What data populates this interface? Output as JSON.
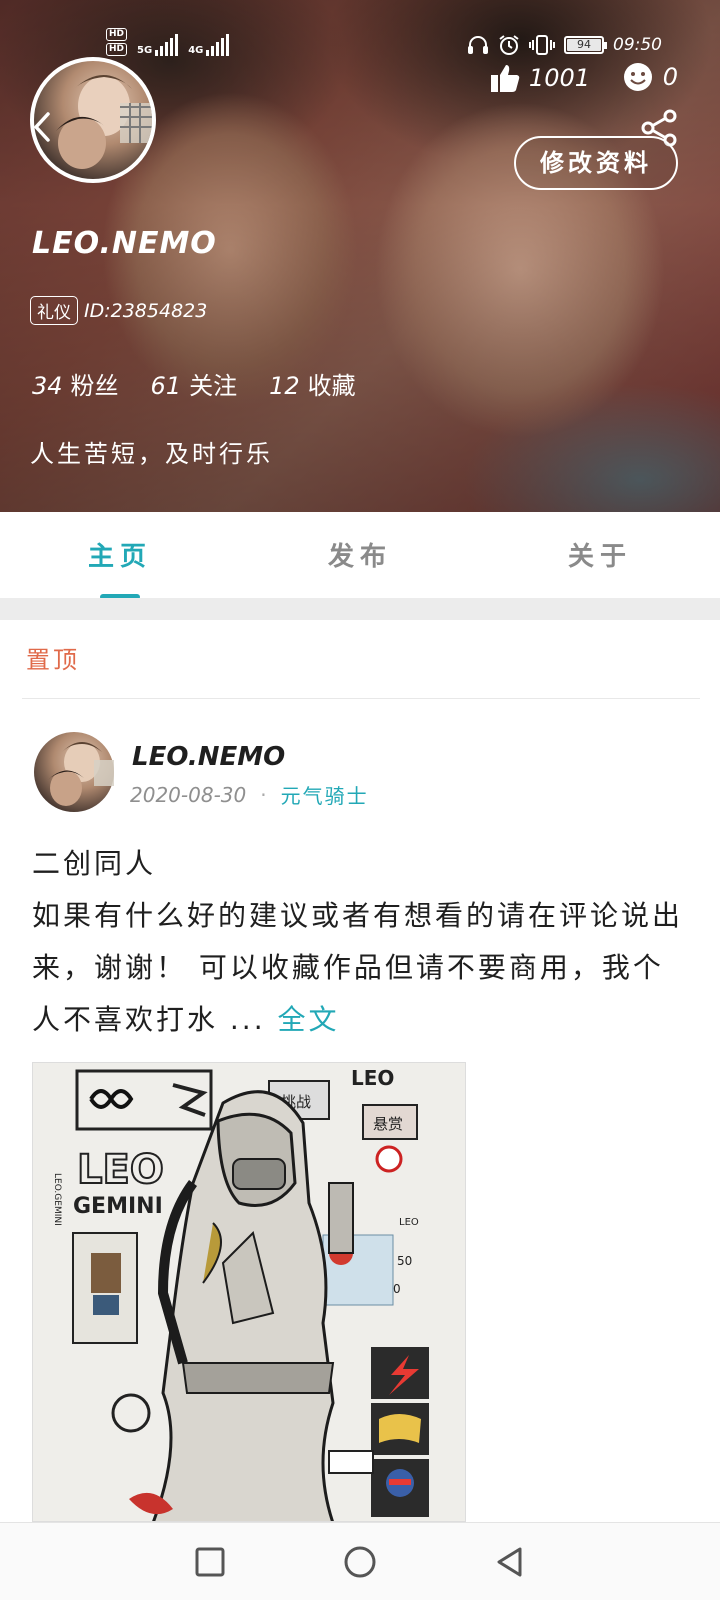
{
  "status_bar": {
    "hd1": "HD",
    "hd2": "HD",
    "net1": "5G",
    "net2": "4G",
    "battery": "94",
    "time": "09:50"
  },
  "profile": {
    "likes": "1001",
    "faces": "0",
    "edit_label": "修改资料",
    "username": "LEO.NEMO",
    "badge": "礼仪",
    "id_text": "ID:23854823",
    "stats": [
      {
        "num": "34",
        "label": "粉丝"
      },
      {
        "num": "61",
        "label": "关注"
      },
      {
        "num": "12",
        "label": "收藏"
      }
    ],
    "bio": "人生苦短，及时行乐"
  },
  "tabs": [
    {
      "label": "主页",
      "active": true
    },
    {
      "label": "发布",
      "active": false
    },
    {
      "label": "关于",
      "active": false
    }
  ],
  "feed": {
    "pinned_label": "置顶",
    "post": {
      "author": "LEO.NEMO",
      "date": "2020-08-30",
      "dot": "·",
      "tag": "元气骑士",
      "line1": "二创同人",
      "body": "如果有什么好的建议或者有想看的请在评论说出来，谢谢！ 可以收藏作品但请不要商用，我个人不喜欢打水 ...",
      "more": "全文"
    }
  },
  "artwork": {
    "texts": [
      "LEO",
      "LEO.GEMINI",
      "挑战",
      "悬赏",
      "LEO",
      "GEMINI",
      "LEO",
      "50",
      "0",
      "LEO"
    ]
  },
  "colors": {
    "accent": "#22a8b6",
    "pinned": "#e06a4a"
  },
  "icons": {
    "back": "back-icon",
    "share": "share-icon",
    "like": "thumbs-up-icon",
    "face": "smiley-icon",
    "nav_recent": "square-icon",
    "nav_home": "circle-icon",
    "nav_back": "triangle-back-icon"
  }
}
